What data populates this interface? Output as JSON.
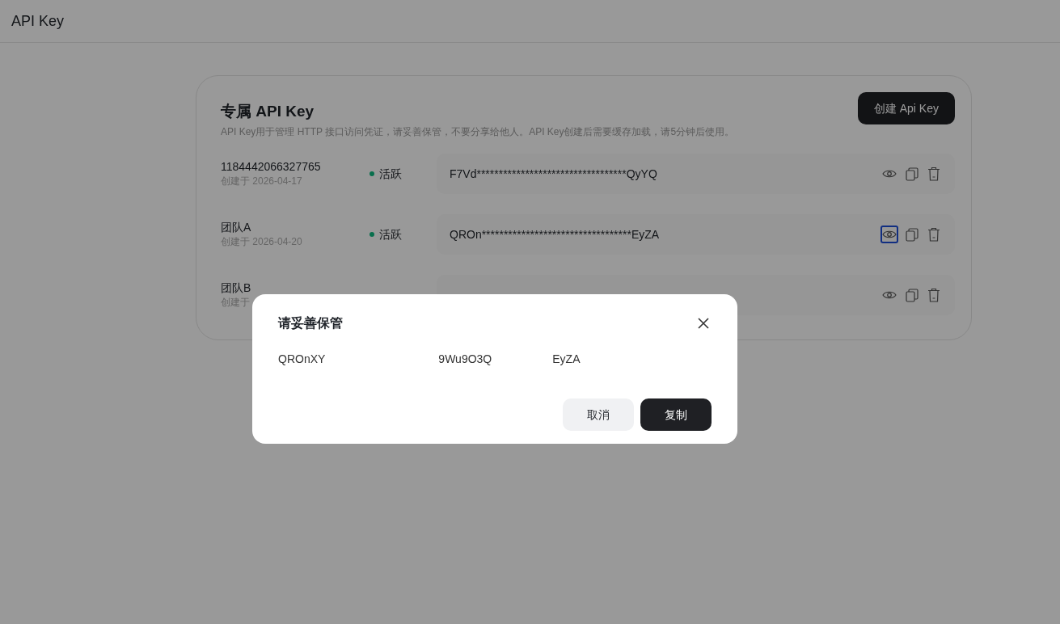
{
  "header": {
    "title": "API Key"
  },
  "card": {
    "title": "专属 API Key",
    "description": "API Key用于管理 HTTP 接口访问凭证，请妥善保管，不要分享给他人。API Key创建后需要缓存加载，请5分钟后使用。",
    "create_button": "创建 Api Key"
  },
  "keys": [
    {
      "name": "1184442066327765",
      "created": "创建于 2026-04-17",
      "status": "活跃",
      "active": true,
      "masked_key": "F7Vd**********************************QyYQ",
      "eye_focused": false
    },
    {
      "name": "团队A",
      "created": "创建于 2026-04-20",
      "status": "活跃",
      "active": true,
      "masked_key": "QROn**********************************EyZA",
      "eye_focused": true
    },
    {
      "name": "团队B",
      "created": "创建于",
      "eye_focused": false
    }
  ],
  "dialog": {
    "title": "请妥善保管",
    "key_parts": [
      "QROnXY",
      "9Wu9O3Q",
      "EyZA"
    ],
    "cancel": "取消",
    "copy": "复制"
  }
}
